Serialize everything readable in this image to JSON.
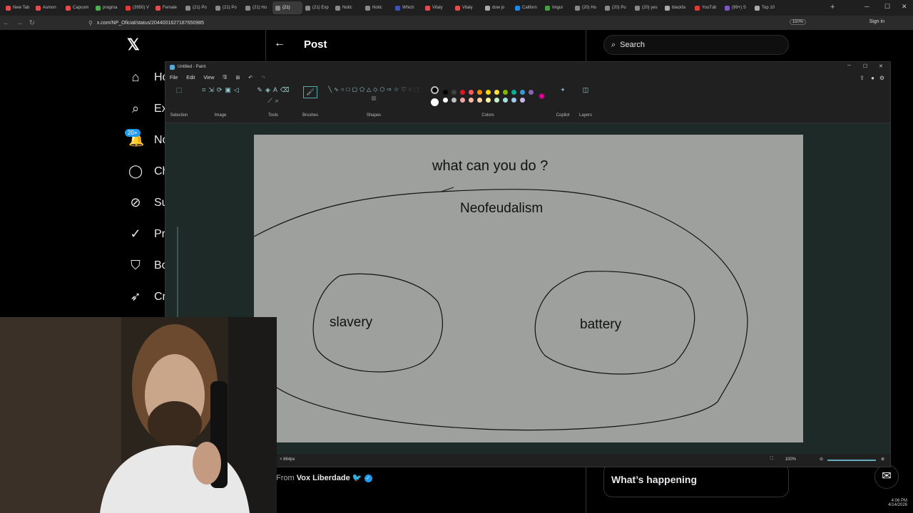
{
  "browser": {
    "tabs": [
      {
        "label": "New Tab",
        "color": "#e34c4c"
      },
      {
        "label": "Asmon",
        "color": "#e34c4c"
      },
      {
        "label": "Capcom",
        "color": "#e34c4c"
      },
      {
        "label": "pragma",
        "color": "#4caf50"
      },
      {
        "label": "(3950) V",
        "color": "#e53935"
      },
      {
        "label": "Female",
        "color": "#e34c4c"
      },
      {
        "label": "(21) Po",
        "color": "#888888"
      },
      {
        "label": "(21) Po",
        "color": "#888888"
      },
      {
        "label": "(21) Ho",
        "color": "#888888"
      },
      {
        "label": "(21)",
        "color": "#888888",
        "active": true
      },
      {
        "label": "(21) Exp",
        "color": "#888888"
      },
      {
        "label": "Notic",
        "color": "#888888"
      },
      {
        "label": "Notic",
        "color": "#888888"
      },
      {
        "label": "Which",
        "color": "#3f51b5"
      },
      {
        "label": "Vitaly",
        "color": "#e34c4c"
      },
      {
        "label": "Vitaly",
        "color": "#e34c4c"
      },
      {
        "label": "dow jo",
        "color": "#aaaaaa"
      },
      {
        "label": "Californ",
        "color": "#1e88e5"
      },
      {
        "label": "Imgur",
        "color": "#43a047"
      },
      {
        "label": "(20) Ho",
        "color": "#888888"
      },
      {
        "label": "(20) Po",
        "color": "#888888"
      },
      {
        "label": "(20) yes",
        "color": "#888888"
      },
      {
        "label": "blackfa",
        "color": "#aaaaaa"
      },
      {
        "label": "YouTub",
        "color": "#e53935"
      },
      {
        "label": "(99+) S",
        "color": "#7e57c2"
      },
      {
        "label": "Top 10",
        "color": "#aaaaaa"
      }
    ],
    "new_tab_symbol": "+",
    "url": "x.com/NP_Oficial/status/2044001627187650985",
    "zoom_chip": "150%",
    "sign_in": "Sign in"
  },
  "x": {
    "nav": [
      {
        "label": "Ho",
        "icon": "home-icon",
        "glyph": "⌂"
      },
      {
        "label": "Ex",
        "icon": "search-icon",
        "glyph": "⌕"
      },
      {
        "label": "No",
        "icon": "bell-icon",
        "glyph": "🔔"
      },
      {
        "label": "Ch",
        "icon": "chat-icon",
        "glyph": "◯"
      },
      {
        "label": "Su",
        "icon": "subscription-icon",
        "glyph": "⊘"
      },
      {
        "label": "Pr",
        "icon": "premium-icon",
        "glyph": "✓"
      },
      {
        "label": "Bo",
        "icon": "bookmark-icon",
        "glyph": "⛉"
      },
      {
        "label": "Cr",
        "icon": "rocket-icon",
        "glyph": "➶"
      }
    ],
    "notif_badge": "20+",
    "post_title": "Post",
    "search_placeholder": "Search",
    "whats_happening": "What’s happening",
    "from_prefix": "From",
    "from_name": "Vox Liberdade"
  },
  "paint": {
    "title": "Untitled - Paint",
    "menu": [
      "File",
      "Edit",
      "View"
    ],
    "ribbon_labels": {
      "selection": "Selection",
      "image": "Image",
      "tools": "Tools",
      "brushes": "Brushes",
      "shapes": "Shapes",
      "colors": "Colors",
      "copilot": "Copilot",
      "layers": "Layers"
    },
    "palette": [
      "#000000",
      "#404040",
      "#e81123",
      "#ff5a5f",
      "#ff8c00",
      "#ffd700",
      "#ffe135",
      "#7fba00",
      "#00b294",
      "#3a96dd",
      "#8764b8",
      "#ffffff",
      "#c0c0c0",
      "#f4a3a3",
      "#ffb8a0",
      "#ffd3a0",
      "#fff5a0",
      "#c6efce",
      "#a0e0d8",
      "#a0c8f0",
      "#c8b4e8"
    ],
    "canvas_text": {
      "question": "what can you do ?",
      "outer": "Neofeudalism",
      "left": "slavery",
      "right": "battery"
    },
    "status": {
      "size": "× 864px",
      "zoom": "100%"
    }
  },
  "tray": {
    "time": "4:06 PM",
    "date": "4/14/2026"
  }
}
